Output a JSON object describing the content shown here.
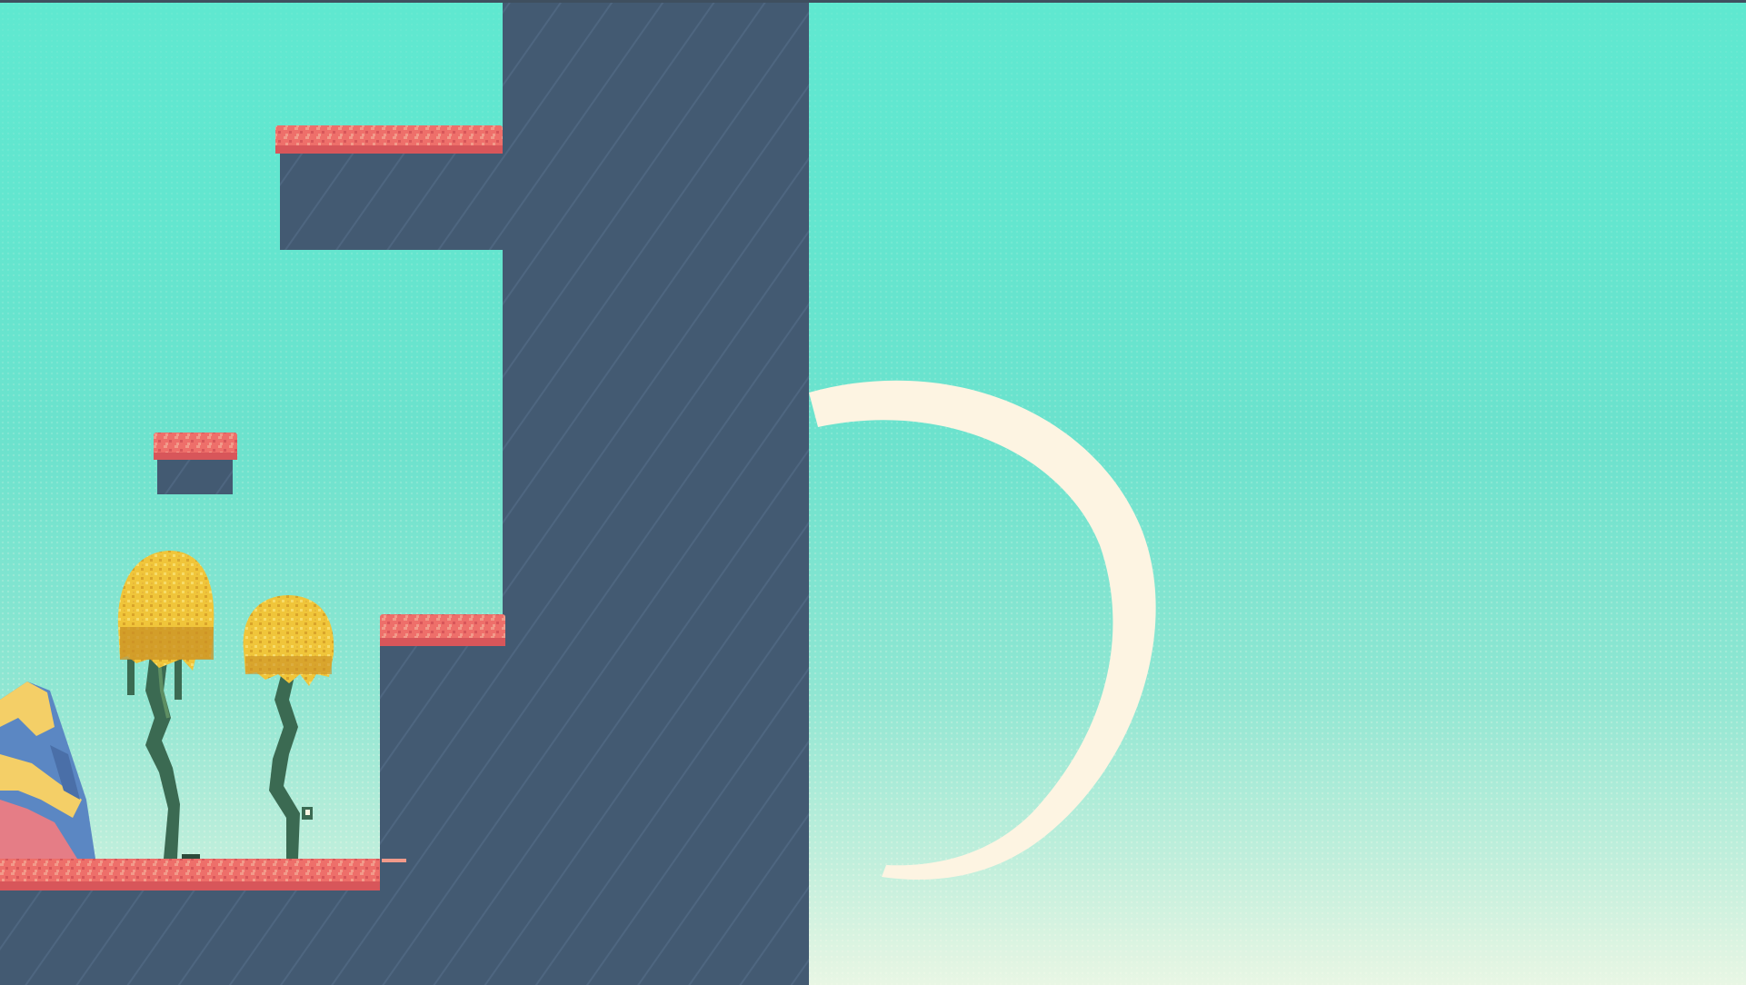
{
  "scene": {
    "colors": {
      "rock": "#435a72",
      "rock_stripe": "#4e6680",
      "grass": "#ee6f6a",
      "grass_light": "#f29a8a",
      "grass_dark": "#d8565a",
      "foliage": "#f0c53a",
      "foliage_dark": "#c99024",
      "stem": "#3b6a52",
      "stem_light": "#5e8f63",
      "halo": "#fdf4e2",
      "crystal_blue": "#5b87c3",
      "crystal_yellow": "#f4cf67",
      "crystal_pink": "#e57d86"
    },
    "objects": [
      "central-rock-pillar",
      "upper-grass-ledge",
      "small-floating-platform",
      "middle-grass-ledge",
      "ground-grass-platform",
      "left-crystal-rock",
      "golden-tree-large",
      "golden-tree-small",
      "sun-halo-arc"
    ]
  }
}
